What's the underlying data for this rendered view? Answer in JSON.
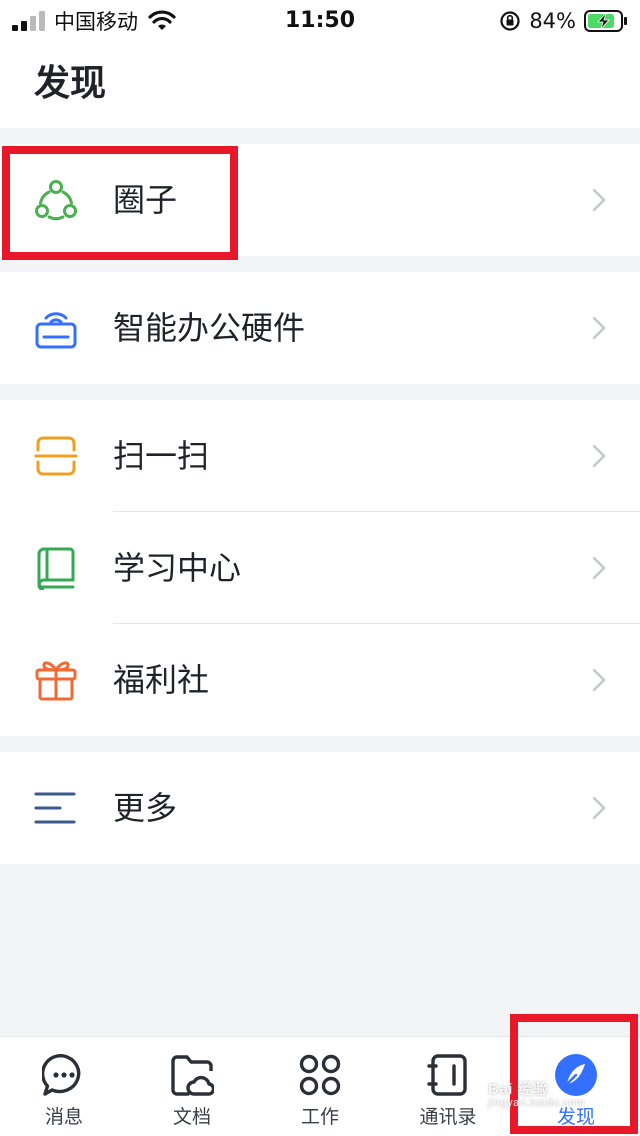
{
  "status_bar": {
    "carrier": "中国移动",
    "time": "11:50",
    "battery": "84%",
    "battery_level": 0.84
  },
  "header": {
    "title": "发现"
  },
  "groups": [
    {
      "items": [
        {
          "label": "圈子",
          "icon": "circle-group-icon",
          "color": "#4caf50"
        }
      ]
    },
    {
      "items": [
        {
          "label": "智能办公硬件",
          "icon": "hardware-router-icon",
          "color": "#3370ff"
        }
      ]
    },
    {
      "items": [
        {
          "label": "扫一扫",
          "icon": "scan-icon",
          "color": "#f0a020"
        },
        {
          "label": "学习中心",
          "icon": "book-icon",
          "color": "#34a853"
        },
        {
          "label": "福利社",
          "icon": "gift-icon",
          "color": "#f06a35"
        }
      ]
    },
    {
      "items": [
        {
          "label": "更多",
          "icon": "more-lines-icon",
          "color": "#3b5b8c"
        }
      ]
    }
  ],
  "tabbar": {
    "tabs": [
      {
        "label": "消息",
        "icon": "chat-bubble-icon"
      },
      {
        "label": "文档",
        "icon": "folder-cloud-icon"
      },
      {
        "label": "工作",
        "icon": "grid-apps-icon"
      },
      {
        "label": "通讯录",
        "icon": "contacts-book-icon"
      },
      {
        "label": "发现",
        "icon": "compass-icon",
        "active": true
      }
    ]
  },
  "annotation": {
    "highlight_color": "#e8182a"
  },
  "watermark": {
    "line1": "Bai 经验",
    "line2": "jingyan.baidu.com"
  },
  "colors": {
    "accent": "#3370ff",
    "background": "#f3f4f6"
  }
}
